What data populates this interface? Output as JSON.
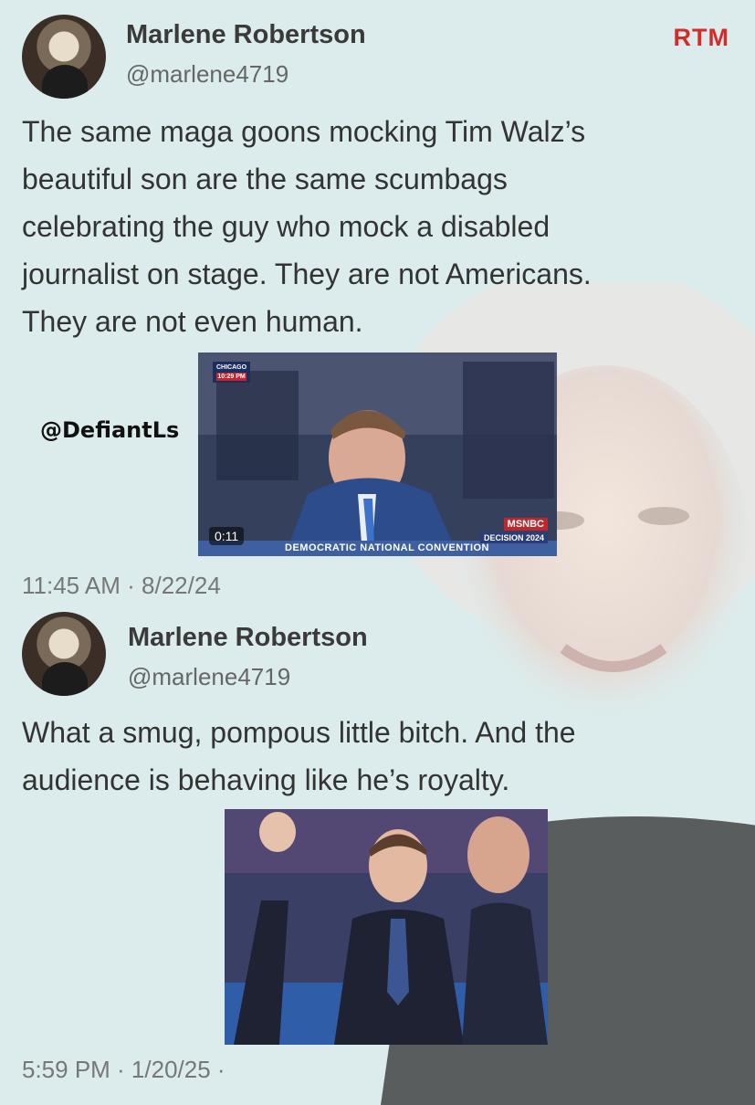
{
  "brand": "RTM",
  "watermark": "@DefiantLs",
  "tweets": [
    {
      "name": "Marlene Robertson",
      "handle": "@marlene4719",
      "text": "The same maga goons mocking Tim Walz’s beautiful son are the same scumbags celebrating the guy who mock a disabled journalist on stage.  They are not Americans. They are not even human.",
      "lines": [
        "The same maga goons mocking Tim Walz’s",
        "beautiful son are the same scumbags",
        "celebrating the guy who mock a disabled",
        "journalist on stage.  They are not Americans.",
        "They are not even human."
      ],
      "timestamp": "11:45 AM · 8/22/24",
      "video": {
        "duration": "0:11",
        "city": "CHICAGO",
        "clock": "10:29 PM",
        "banner": "DEMOCRATIC NATIONAL CONVENTION",
        "network": "MSNBC",
        "program": "DECISION 2024"
      }
    },
    {
      "name": "Marlene Robertson",
      "handle": "@marlene4719",
      "text": "What a smug, pompous little bitch.   And the audience is behaving like he’s royalty.",
      "lines": [
        "What a smug, pompous little bitch.   And the",
        "audience is behaving like he’s royalty."
      ],
      "timestamp": "5:59 PM · 1/20/25 ·"
    }
  ],
  "colors": {
    "background": "#dcecec",
    "brand_red": "#d42b2b",
    "text": "#333333"
  }
}
